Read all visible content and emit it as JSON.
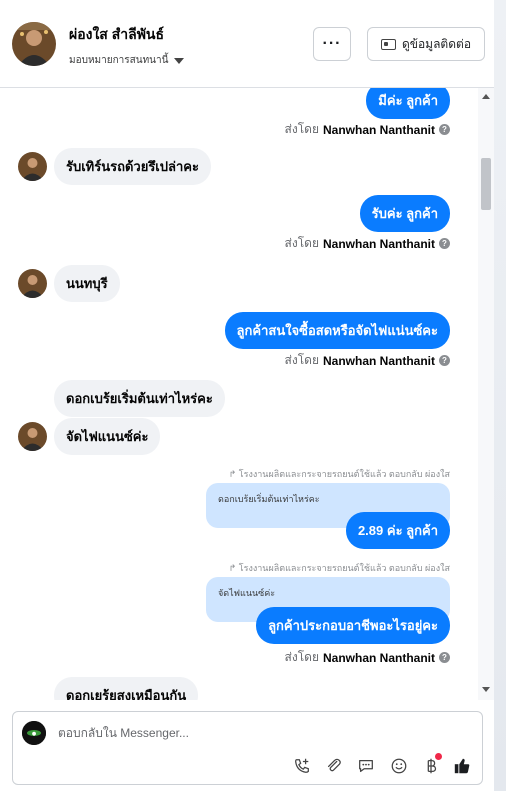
{
  "header": {
    "name": "ผ่องใส สำลีพันธ์",
    "assign_label": "มอบหมายการสนทนานี้",
    "more_label": "···",
    "contact_label": "ดูข้อมูลติดต่อ"
  },
  "messages": {
    "m1": "มีค่ะ ลูกค้า",
    "m2": "รับเทิร์นรถด้วยรึเปล่าคะ",
    "m3": "รับค่ะ ลูกค้า",
    "m4": "นนทบุรี",
    "m5": "ลูกค้าสนใจซื้อสดหรือจัดไฟแน่นซ์คะ",
    "m6": "ดอกเบร้ยเริ่มต้นเท่าไหร่คะ",
    "m7": "จัดไฟแนนซ์ค่ะ",
    "m8_reply_meta": "โรงงานผลิตและกระจายรถยนต์ใช้แล้ว ตอบกลับ ผ่องใส",
    "m8_quote": "ดอกเบร้ยเริ่มต้นเท่าไหร่คะ",
    "m8": "2.89 ค่ะ ลูกค้า",
    "m9_reply_meta": "โรงงานผลิตและกระจายรถยนต์ใช้แล้ว ตอบกลับ ผ่องใส",
    "m9_quote": "จัดไฟแนนซ์ค่ะ",
    "m9": "ลูกค้าประกอบอาชีพอะไรอยู่คะ",
    "m10": "ดอกเยร้ยสงเหมือนกัน"
  },
  "sent_by": {
    "prefix": "ส่งโดย",
    "agent": "Nanwhan Nanthanit",
    "help": "?"
  },
  "composer": {
    "placeholder": "ตอบกลับใน Messenger..."
  },
  "colors": {
    "outgoing_bubble": "#0a7cff",
    "incoming_bubble": "#f0f2f5",
    "quote_bubble": "#cfe5ff",
    "badge_dot": "#f02849"
  }
}
